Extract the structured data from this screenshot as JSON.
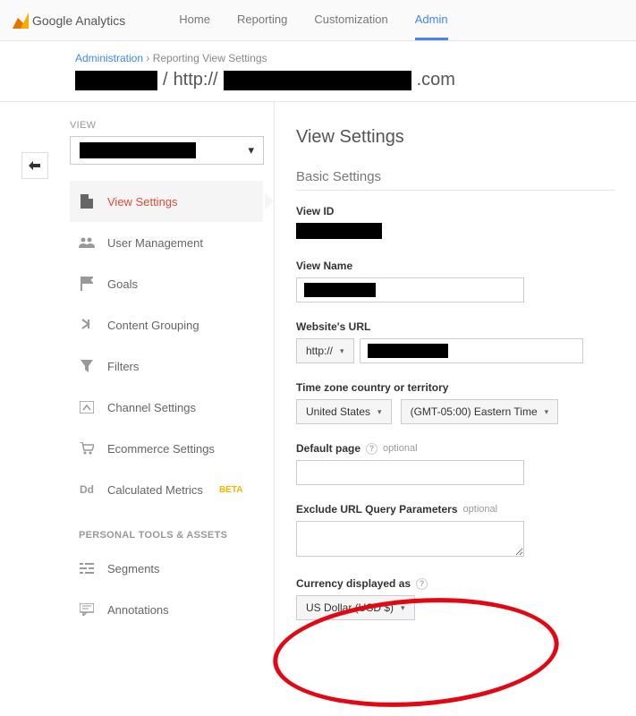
{
  "header": {
    "logo": "Google Analytics",
    "nav": {
      "home": "Home",
      "reporting": "Reporting",
      "customization": "Customization",
      "admin": "Admin"
    }
  },
  "breadcrumb": {
    "admin": "Administration",
    "page": "Reporting View Settings"
  },
  "account_line": {
    "slash": " / ",
    "protocol": "http://",
    "tld": ".com"
  },
  "sidebar": {
    "view_label": "VIEW",
    "items": [
      {
        "label": "View Settings"
      },
      {
        "label": "User Management"
      },
      {
        "label": "Goals"
      },
      {
        "label": "Content Grouping"
      },
      {
        "label": "Filters"
      },
      {
        "label": "Channel Settings"
      },
      {
        "label": "Ecommerce Settings"
      },
      {
        "label": "Calculated Metrics",
        "beta": "BETA"
      }
    ],
    "section2_title": "PERSONAL TOOLS & ASSETS",
    "section2": [
      {
        "label": "Segments"
      },
      {
        "label": "Annotations"
      }
    ]
  },
  "settings": {
    "title": "View Settings",
    "basic": "Basic Settings",
    "view_id_label": "View ID",
    "view_name_label": "View Name",
    "website_url_label": "Website's URL",
    "protocol_option": "http://",
    "timezone_label": "Time zone country or territory",
    "tz_country": "United States",
    "tz_zone": "(GMT-05:00) Eastern Time",
    "default_page_label": "Default page",
    "optional": "optional",
    "exclude_label": "Exclude URL Query Parameters",
    "currency_label": "Currency displayed as",
    "currency_value": "US Dollar (USD $)"
  }
}
